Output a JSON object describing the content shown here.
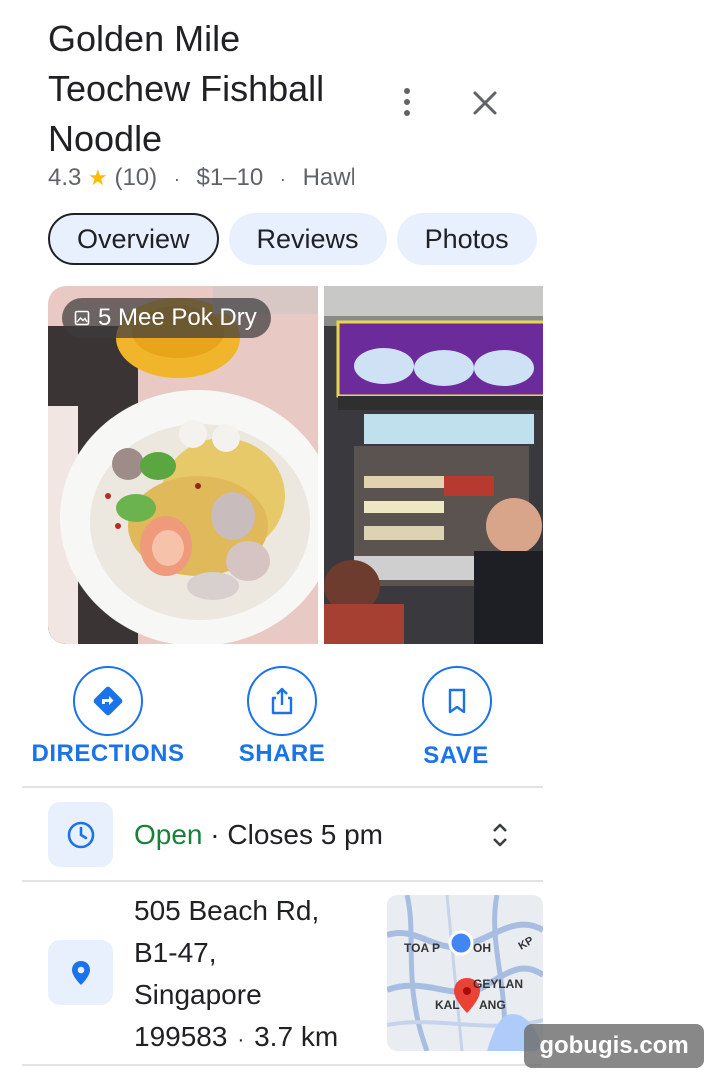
{
  "place": {
    "title": "Golden Mile Teochew Fishball Noodle",
    "rating": "4.3",
    "review_count": "(10)",
    "price": "$1–10",
    "category": "Hawk"
  },
  "tabs": [
    {
      "label": "Overview",
      "active": true
    },
    {
      "label": "Reviews",
      "active": false
    },
    {
      "label": "Photos",
      "active": false
    }
  ],
  "photos": {
    "first_caption": "5 Mee Pok Dry"
  },
  "actions": [
    {
      "label": "DIRECTIONS",
      "icon": "directions-icon"
    },
    {
      "label": "SHARE",
      "icon": "share-icon"
    },
    {
      "label": "SAVE",
      "icon": "bookmark-icon"
    }
  ],
  "hours": {
    "status": "Open",
    "separator": " · ",
    "closes": "Closes 5 pm"
  },
  "address": {
    "line1": "505 Beach Rd,",
    "line2": "B1-47,",
    "line3": "Singapore",
    "postal": "199583",
    "distance": "3.7 km"
  },
  "map": {
    "labels": [
      "TOA P",
      "OH",
      "GEYLAN",
      "KAL",
      "ANG",
      "KP"
    ]
  },
  "watermark": "gobugis.com",
  "colors": {
    "accent": "#1a73e8",
    "open": "#188038",
    "chip_bg": "#e8f0fe",
    "star": "#fbbc04",
    "pin": "#ea4335"
  }
}
